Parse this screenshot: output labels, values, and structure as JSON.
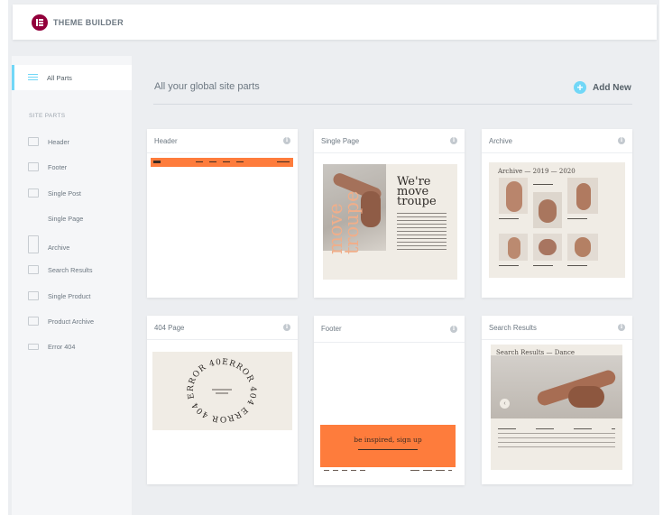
{
  "app": {
    "title": "THEME BUILDER"
  },
  "sidebar": {
    "all_parts": "All Parts",
    "section_label": "SITE PARTS",
    "items": [
      {
        "label": "Header",
        "icon": "header-layout-icon"
      },
      {
        "label": "Footer",
        "icon": "footer-layout-icon"
      },
      {
        "label": "Single Post",
        "icon": "single-post-icon"
      },
      {
        "label": "Single Page",
        "icon": ""
      },
      {
        "label": "Archive",
        "icon": "archive-icon"
      },
      {
        "label": "Search Results",
        "icon": "search-results-icon"
      },
      {
        "label": "Single Product",
        "icon": "single-product-icon"
      },
      {
        "label": "Product Archive",
        "icon": "product-archive-icon"
      },
      {
        "label": "Error 404",
        "icon": "error-404-icon"
      }
    ]
  },
  "main": {
    "title": "All your global site parts",
    "add_new": "Add New",
    "cards": [
      {
        "label": "Header"
      },
      {
        "label": "Single Page"
      },
      {
        "label": "Archive"
      },
      {
        "label": "404 Page"
      },
      {
        "label": "Footer"
      },
      {
        "label": "Search Results"
      }
    ]
  },
  "previews": {
    "single_page_heading": "We're move troupe",
    "single_page_vertical": "move troupe",
    "archive_heading": "Archive — 2019 — 2020",
    "error_ring": "ERROR 404 ERROR 404 ERROR 404",
    "footer_cta": "be inspired, sign up",
    "search_heading": "Search Results — Dance"
  },
  "colors": {
    "accent": "#71d7f7",
    "brand": "#92003b",
    "orange": "#fe7c3c"
  }
}
